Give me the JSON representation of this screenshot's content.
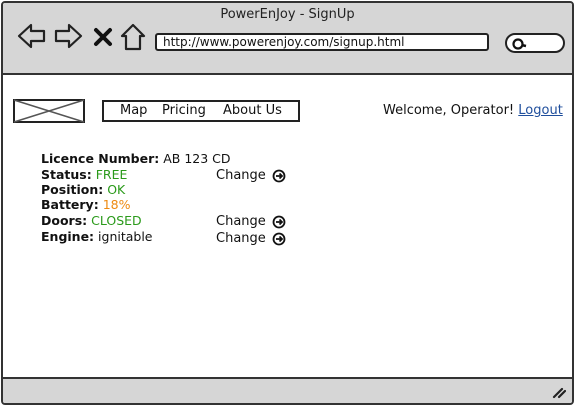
{
  "window": {
    "title": "PowerEnJoy - SignUp"
  },
  "browser": {
    "url": "http://www.powerenjoy.com/signup.html"
  },
  "menu": {
    "items": [
      "Map",
      "Pricing",
      "About Us"
    ]
  },
  "user": {
    "welcome": "Welcome, Operator!",
    "logout": "Logout"
  },
  "car": {
    "licence_label": "Licence Number:",
    "licence_value": "AB 123 CD",
    "status_label": "Status:",
    "status_value": "FREE",
    "position_label": "Position:",
    "position_value": "OK",
    "battery_label": "Battery:",
    "battery_value": "18%",
    "doors_label": "Doors:",
    "doors_value": "CLOSED",
    "engine_label": "Engine:",
    "engine_value": "ignitable"
  },
  "actions": {
    "change_label": "Change"
  },
  "colors": {
    "ok": "#2a9a1a",
    "warning": "#ee8a11",
    "link": "#1f4e9c",
    "chrome": "#d6d6d6"
  }
}
